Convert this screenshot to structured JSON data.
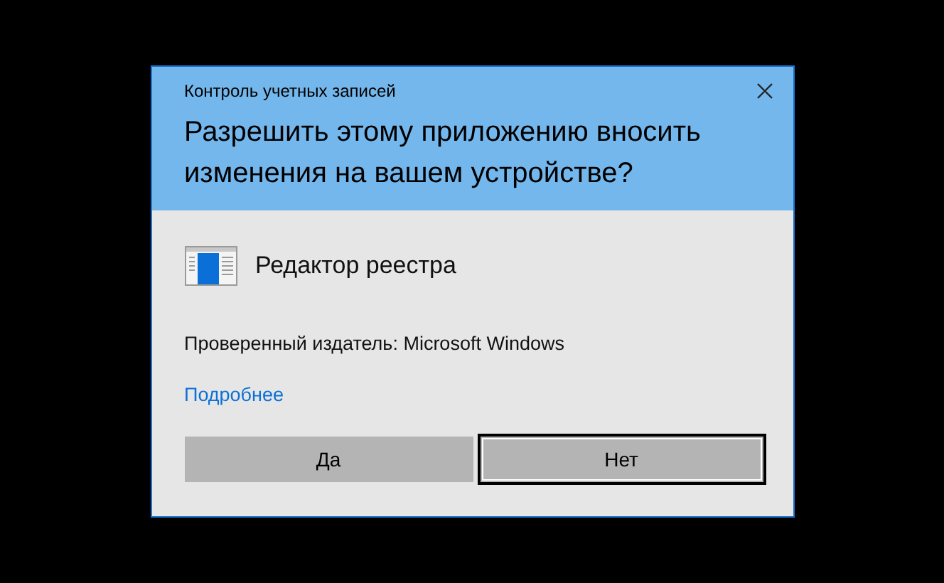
{
  "window": {
    "title": "Контроль учетных записей"
  },
  "question": "Разрешить этому приложению вносить изменения на вашем устройстве?",
  "app": {
    "name": "Редактор реестра"
  },
  "publisher": "Проверенный издатель: Microsoft Windows",
  "details_link": "Подробнее",
  "buttons": [
    {
      "label": "Да",
      "focused": false
    },
    {
      "label": "Нет",
      "focused": true
    }
  ]
}
